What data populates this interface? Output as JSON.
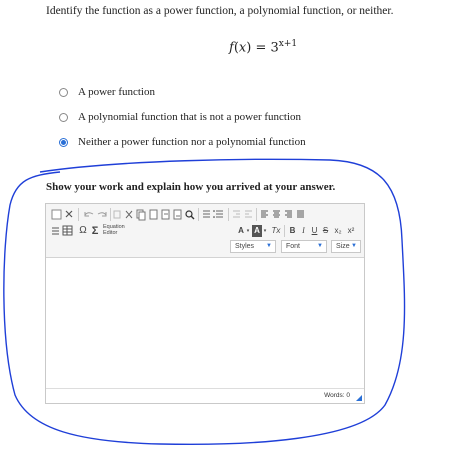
{
  "question": {
    "text": "Identify the function as a power function, a polynomial function, or neither.",
    "formula": {
      "lhs_name": "f",
      "lhs_var": "x",
      "base": "3",
      "exponent": "x+1"
    }
  },
  "options": [
    {
      "label": "A power function",
      "selected": false
    },
    {
      "label": "A polynomial function that is not a power function",
      "selected": false
    },
    {
      "label": "Neither a power function nor a polynomial function",
      "selected": true
    }
  ],
  "prompt": "Show your work and explain how you arrived at your answer.",
  "editor": {
    "equation_label_top": "Equation",
    "equation_label_bottom": "Editor",
    "format_labels": {
      "bold": "B",
      "italic": "I",
      "underline": "U",
      "strike": "S",
      "subscript": "x₂",
      "superscript": "x²"
    },
    "text_color_label": "A",
    "bg_color_label": "A",
    "clear_format_label": "Tx",
    "omega": "Ω",
    "sigma": "Σ",
    "styles_label": "Styles",
    "font_label": "Font",
    "size_label": "Size",
    "words_label": "Words: 0",
    "content": ""
  },
  "colors": {
    "accent": "#2a6fd6",
    "scribble": "#1f3fd8"
  }
}
